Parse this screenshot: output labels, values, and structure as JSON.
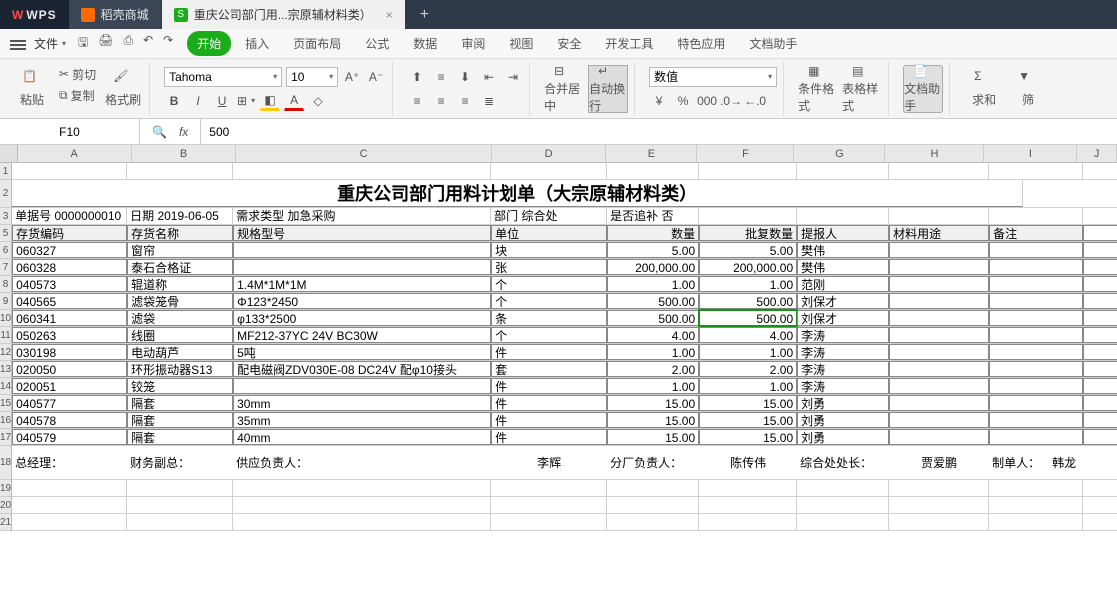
{
  "titlebar": {
    "wps": "WPS",
    "tab1": "稻壳商城",
    "tab2": "重庆公司部门用...宗原辅材料类）",
    "close": "×",
    "add": "+"
  },
  "menubar": {
    "file": "文件",
    "tabs": [
      "开始",
      "插入",
      "页面布局",
      "公式",
      "数据",
      "审阅",
      "视图",
      "安全",
      "开发工具",
      "特色应用",
      "文档助手"
    ],
    "active_index": 0
  },
  "ribbon": {
    "paste": "粘贴",
    "cut": "剪切",
    "copy": "复制",
    "format_painter": "格式刷",
    "font_name": "Tahoma",
    "font_size": "10",
    "merge": "合并居中",
    "wrap": "自动换行",
    "number_format": "数值",
    "cond_format": "条件格式",
    "table_style": "表格样式",
    "doc_helper": "文档助手",
    "sum": "求和",
    "filter": "筛"
  },
  "formula_bar": {
    "cell_ref": "F10",
    "fx": "fx",
    "value": "500"
  },
  "columns": [
    "A",
    "B",
    "C",
    "D",
    "E",
    "F",
    "G",
    "H",
    "I",
    "J"
  ],
  "sheet": {
    "title": "重庆公司部门用料计划单（大宗原辅材料类）",
    "meta_row": {
      "a": "单据号 0000000010",
      "b": "日期 2019-06-05",
      "c": "需求类型 加急采购",
      "d": "部门 综合处",
      "e": "是否追补 否"
    },
    "headers": [
      "存货编码",
      "存货名称",
      "规格型号",
      "单位",
      "数量",
      "批复数量",
      "提报人",
      "材料用途",
      "备注"
    ],
    "rows": [
      {
        "code": "060327",
        "name": "窗帘",
        "spec": "",
        "unit": "块",
        "qty": "5.00",
        "approved": "5.00",
        "person": "樊伟"
      },
      {
        "code": "060328",
        "name": "泰石合格证",
        "spec": "",
        "unit": "张",
        "qty": "200,000.00",
        "approved": "200,000.00",
        "person": "樊伟"
      },
      {
        "code": "040573",
        "name": "辊道称",
        "spec": "1.4M*1M*1M",
        "unit": "个",
        "qty": "1.00",
        "approved": "1.00",
        "person": "范刚"
      },
      {
        "code": "040565",
        "name": "滤袋笼骨",
        "spec": "Φ123*2450",
        "unit": "个",
        "qty": "500.00",
        "approved": "500.00",
        "person": "刘保才"
      },
      {
        "code": "060341",
        "name": "滤袋",
        "spec": "φ133*2500",
        "unit": "条",
        "qty": "500.00",
        "approved": "500.00",
        "person": "刘保才"
      },
      {
        "code": "050263",
        "name": "线圈",
        "spec": "MF212-37YC 24V BC30W",
        "unit": "个",
        "qty": "4.00",
        "approved": "4.00",
        "person": "李涛"
      },
      {
        "code": "030198",
        "name": "电动葫芦",
        "spec": "5吨",
        "unit": "件",
        "qty": "1.00",
        "approved": "1.00",
        "person": "李涛"
      },
      {
        "code": "020050",
        "name": "环形振动器S13",
        "spec": "配电磁阀ZDV030E-08 DC24V 配φ10接头",
        "unit": "套",
        "qty": "2.00",
        "approved": "2.00",
        "person": "李涛"
      },
      {
        "code": "020051",
        "name": "铰笼",
        "spec": "",
        "unit": "件",
        "qty": "1.00",
        "approved": "1.00",
        "person": "李涛"
      },
      {
        "code": "040577",
        "name": "隔套",
        "spec": "30mm",
        "unit": "件",
        "qty": "15.00",
        "approved": "15.00",
        "person": "刘勇"
      },
      {
        "code": "040578",
        "name": "隔套",
        "spec": "35mm",
        "unit": "件",
        "qty": "15.00",
        "approved": "15.00",
        "person": "刘勇"
      },
      {
        "code": "040579",
        "name": "隔套",
        "spec": "40mm",
        "unit": "件",
        "qty": "15.00",
        "approved": "15.00",
        "person": "刘勇"
      }
    ],
    "signatures": {
      "gm": "总经理：",
      "finance": "财务副总：",
      "supplier": "供应负责人：",
      "d_val": "李辉",
      "branch": "分厂负责人：",
      "branch_val": "陈传伟",
      "office": "综合处处长：",
      "office_val": "贾爱鹏",
      "maker": "制单人：",
      "maker_val": "韩龙"
    }
  }
}
